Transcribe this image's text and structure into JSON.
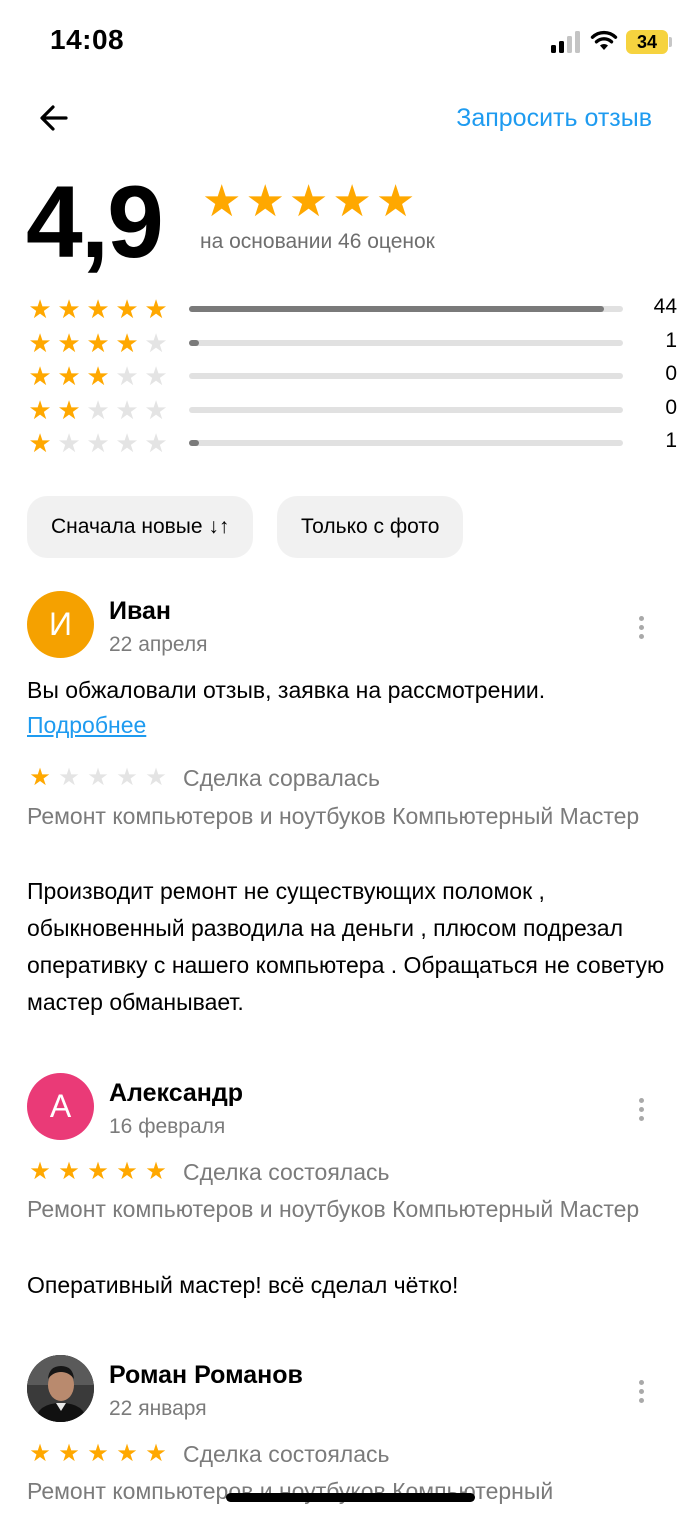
{
  "status_bar": {
    "time": "14:08",
    "battery": "34",
    "icons": [
      "cellular-signal-icon",
      "wifi-icon",
      "battery-icon"
    ]
  },
  "header": {
    "back_icon": "arrow-left-icon",
    "request_review_label": "Запросить отзыв"
  },
  "summary": {
    "average": "4,9",
    "stars_filled": 5,
    "basis_text": "на основании 46 оценок",
    "distribution": [
      {
        "stars": 5,
        "count": "44",
        "share": 0.957
      },
      {
        "stars": 4,
        "count": "1",
        "share": 0.022
      },
      {
        "stars": 3,
        "count": "0",
        "share": 0
      },
      {
        "stars": 2,
        "count": "0",
        "share": 0
      },
      {
        "stars": 1,
        "count": "1",
        "share": 0.022
      }
    ]
  },
  "filters": {
    "sort_label": "Сначала новые ↓↑",
    "photo_only_label": "Только с фото"
  },
  "reviews": [
    {
      "name": "Иван",
      "initial": "И",
      "avatar_color": "#f5a100",
      "date": "22 апреля",
      "appeal_text": "Вы обжаловали отзыв, заявка на рассмотрении.",
      "details_link": "Подробнее",
      "stars": 1,
      "deal_status": "Сделка сорвалась",
      "service": "Ремонт компьютеров и ноутбуков Компьютерный Мастер",
      "text": "Производит ремонт не существующих  поломок , обыкновенный разводила на деньги , плюсом подрезал оперативку с нашего компьютера . Обращаться не советую мастер обманывает."
    },
    {
      "name": "Александр",
      "initial": "А",
      "avatar_color": "#ea3a77",
      "date": "16 февраля",
      "stars": 5,
      "deal_status": "Сделка состоялась",
      "service": "Ремонт компьютеров и ноутбуков Компьютерный Мастер",
      "text": "Оперативный мастер! всё сделал чётко!"
    },
    {
      "name": "Роман Романов",
      "date": "22 января",
      "stars": 5,
      "deal_status": "Сделка состоялась",
      "service": "Ремонт компьютеров и ноутбуков Компьютерный"
    }
  ],
  "colors": {
    "accent": "#1e9bf0",
    "star": "#ffa800",
    "star_empty": "#e4e4e4",
    "muted_text": "#7b7b7b"
  }
}
